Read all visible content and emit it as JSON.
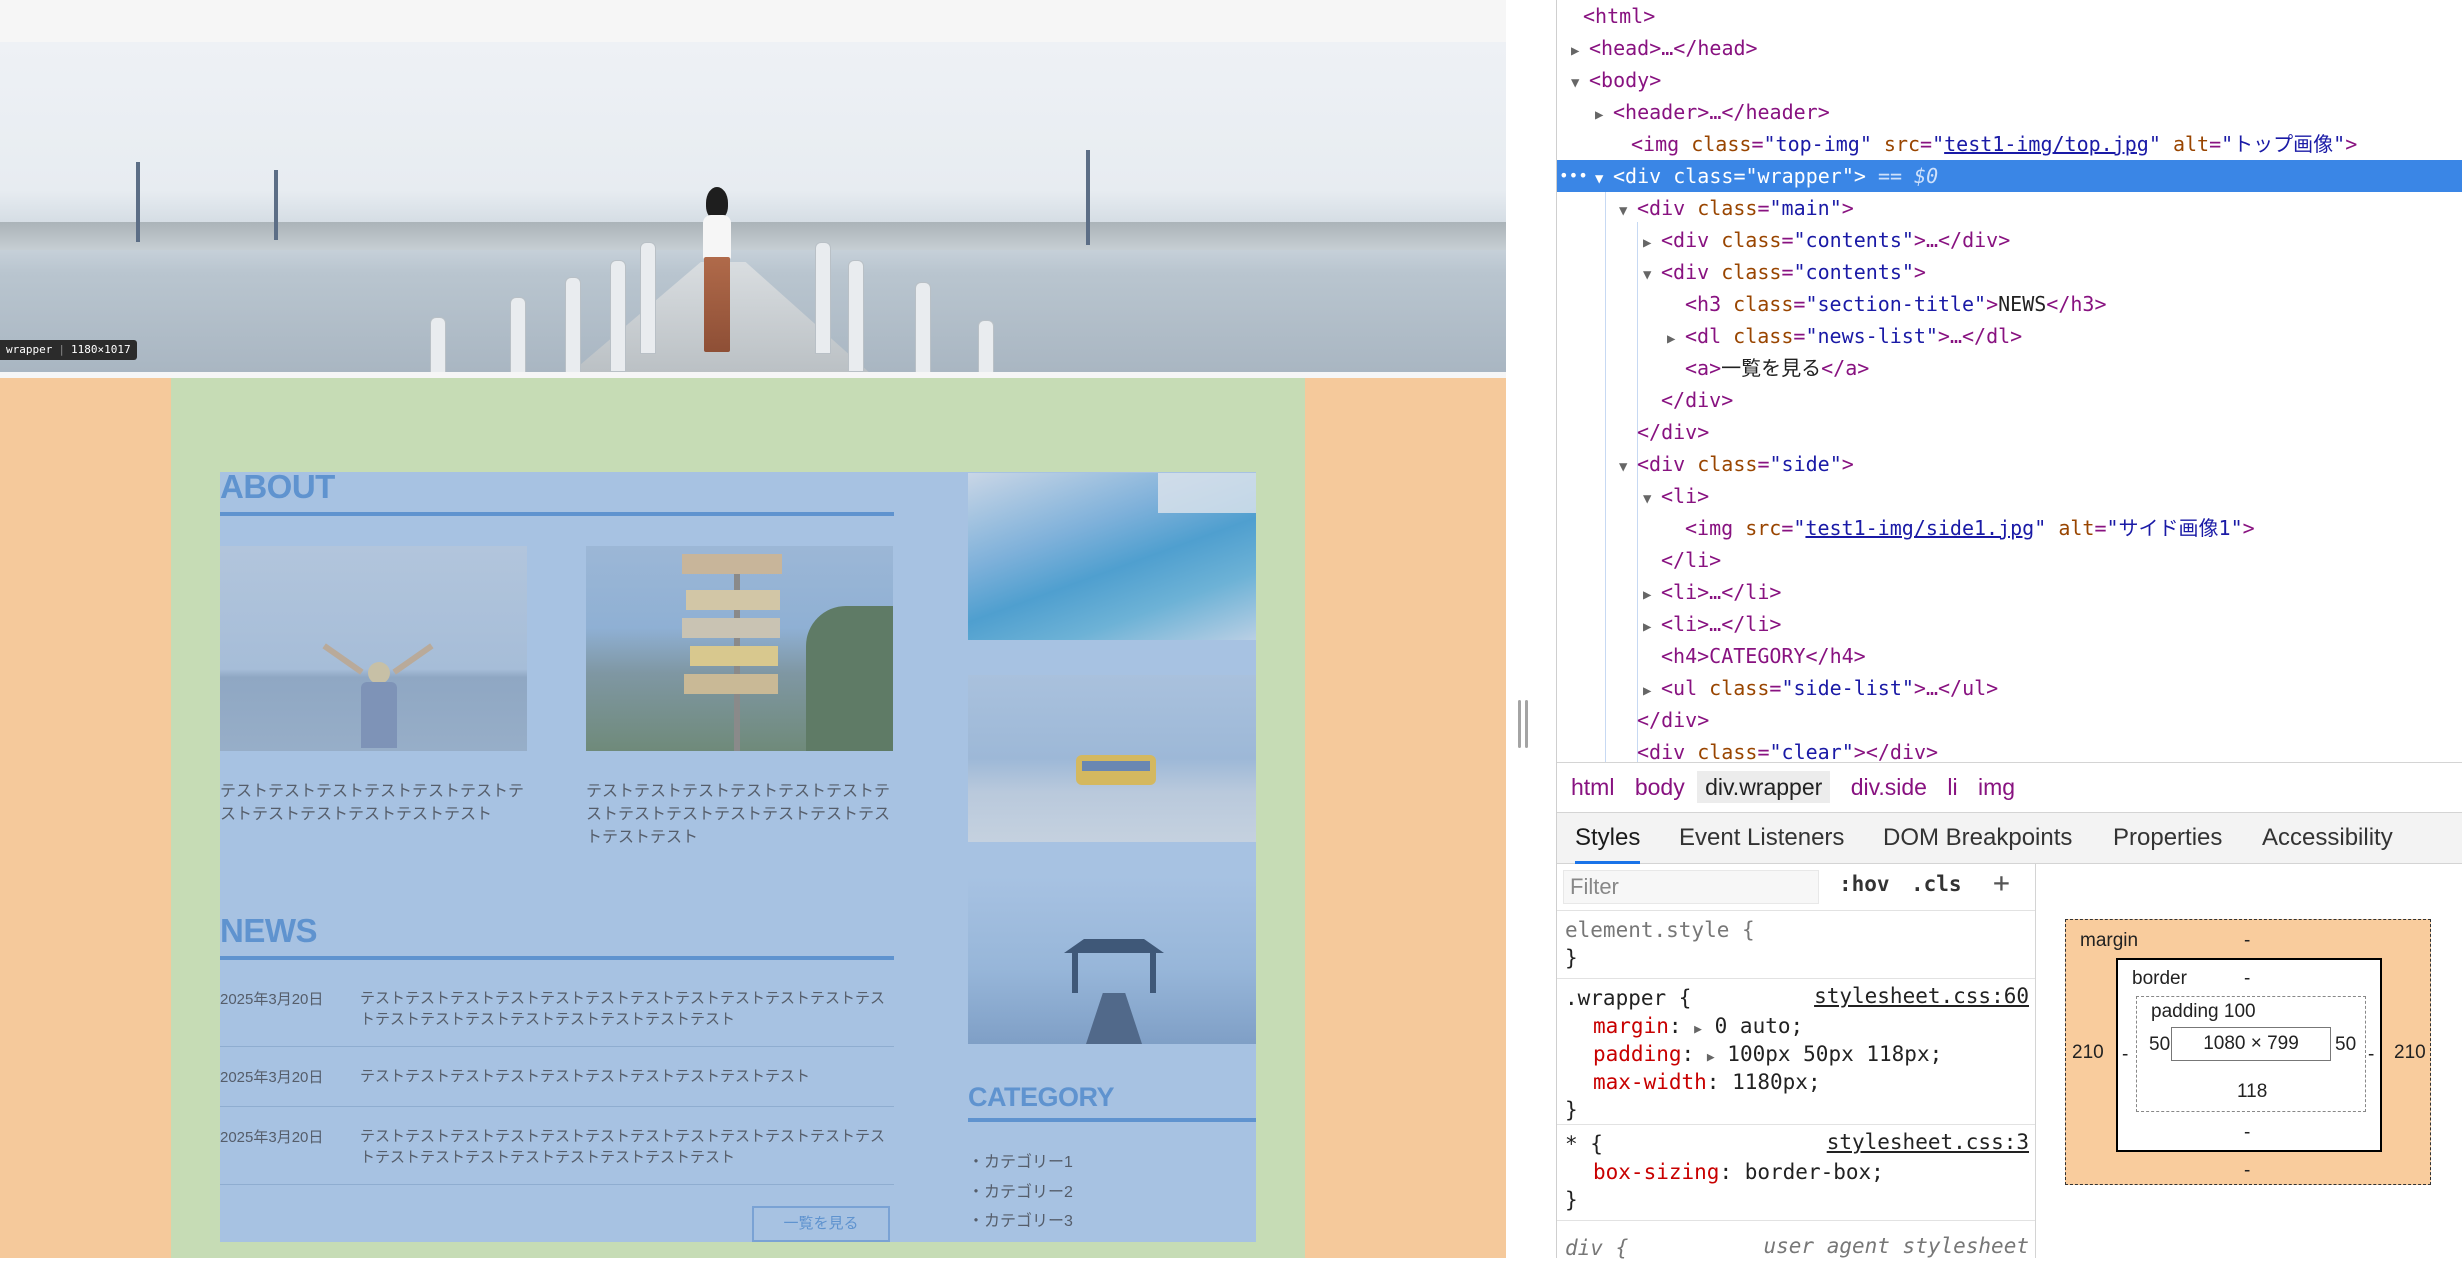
{
  "preview": {
    "hero_tag": {
      "name": "wrapper",
      "size": "1180×1017"
    },
    "about": {
      "title": "ABOUT",
      "text1": "テストテストテストテストテストテストテストテストテストテストテストテスト",
      "text2": "テストテストテストテストテストテストテストテストテストテストテストテストテストテストテスト"
    },
    "news": {
      "title": "NEWS",
      "items": [
        {
          "date": "2025年3月20日",
          "text": "テストテストテストテストテストテストテストテストテストテストテストテストテストテストテストテストテストテストテストテスト"
        },
        {
          "date": "2025年3月20日",
          "text": "テストテストテストテストテストテストテストテストテストテスト"
        },
        {
          "date": "2025年3月20日",
          "text": "テストテストテストテストテストテストテストテストテストテストテストテストテストテストテストテストテストテストテストテスト"
        }
      ],
      "more_label": "一覧を見る"
    },
    "category": {
      "title": "CATEGORY",
      "items": [
        "・カテゴリー1",
        "・カテゴリー2",
        "・カテゴリー3"
      ]
    },
    "colors": {
      "margin": "#f5c99b",
      "padding": "#c6dcb5",
      "content": "#a7c2e2",
      "accent": "#5f93cf"
    }
  },
  "devtools": {
    "dom": {
      "l0": "<html>",
      "l1": "<head>…</head>",
      "l2": "<body>",
      "l3": "<header>…</header>",
      "l4": {
        "tag": "img",
        "class": "top-img",
        "src": "test1-img/top.jpg",
        "alt": "トップ画像"
      },
      "l5": {
        "tag": "div",
        "class": "wrapper",
        "marker": "== $0"
      },
      "l6": {
        "class": "main"
      },
      "l7": {
        "class": "contents"
      },
      "l8": {
        "class": "contents"
      },
      "l9": {
        "class": "section-title",
        "text": "NEWS"
      },
      "l10": {
        "class": "news-list"
      },
      "l11": {
        "text": "一覧を見る"
      },
      "l12": "</div>",
      "l13": "</div>",
      "l14": {
        "class": "side"
      },
      "l15": "<li>",
      "l16": {
        "src": "test1-img/side1.jpg",
        "alt": "サイド画像1"
      },
      "l17": "</li>",
      "l18": "<li>…</li>",
      "l19": "<li>…</li>",
      "l20": "<h4>CATEGORY</h4>",
      "l21": {
        "class": "side-list"
      },
      "l22": "</div>",
      "l23": {
        "class": "clear"
      }
    },
    "breadcrumbs": [
      "html",
      "body",
      "div.wrapper",
      "div.side",
      "li",
      "img"
    ],
    "tabs": [
      "Styles",
      "Event Listeners",
      "DOM Breakpoints",
      "Properties",
      "Accessibility"
    ],
    "styles": {
      "filter_placeholder": "Filter",
      "hov": ":hov",
      "cls": ".cls",
      "plus": "+",
      "element_style": "element.style {",
      "close": "}",
      "wrapper_rule": {
        "selector": ".wrapper {",
        "source": "stylesheet.css:60",
        "props": [
          {
            "name": "margin",
            "value": "0 auto;"
          },
          {
            "name": "padding",
            "value": "100px 50px 118px;"
          },
          {
            "name": "max-width",
            "value": "1180px;"
          }
        ]
      },
      "star_rule": {
        "selector": "* {",
        "source": "stylesheet.css:3",
        "props": [
          {
            "name": "box-sizing",
            "value": "border-box;"
          }
        ]
      },
      "cut_rule": {
        "selector": "div {",
        "source": "user agent stylesheet"
      }
    },
    "box_model": {
      "margin_label": "margin",
      "margin_top": "-",
      "margin_bottom": "-",
      "margin_left": "210",
      "margin_right": "210",
      "border_label": "border",
      "border_top": "-",
      "border_bottom": "-",
      "border_left": "-",
      "border_right": "-",
      "padding_label": "padding 100",
      "padding_left": "50",
      "padding_right": "50",
      "padding_bottom": "118",
      "content": "1080 × 799"
    }
  }
}
